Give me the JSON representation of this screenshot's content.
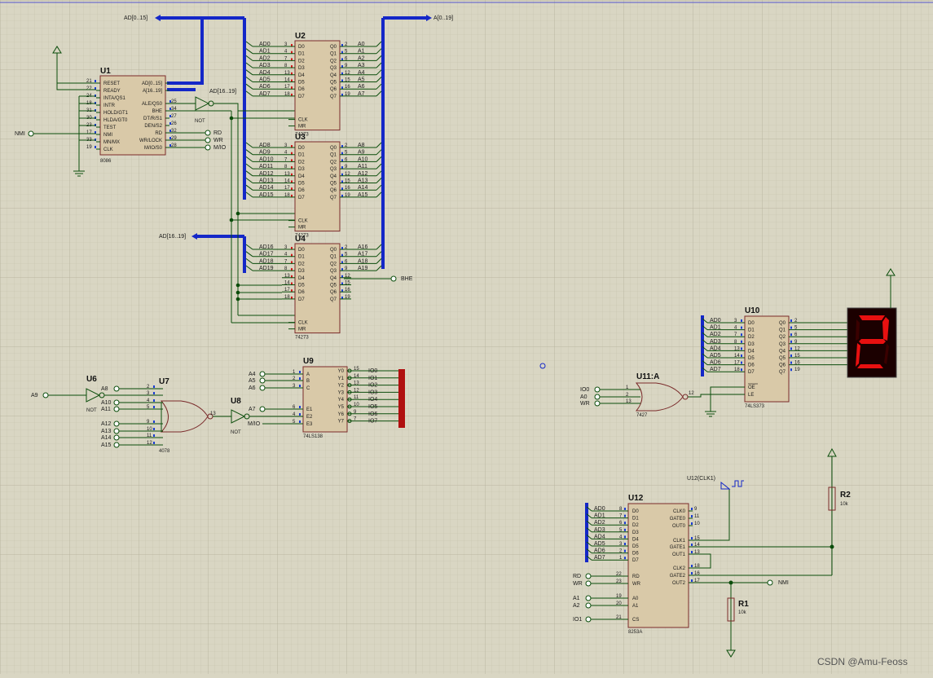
{
  "watermark": "CSDN @Amu-Feoss",
  "buses": {
    "ad0_15": "AD[0..15]",
    "a0_19": "A[0..19]",
    "ad16_19": "AD[16..19]",
    "ad16_19_b": "AD[16..19]"
  },
  "u1": {
    "ref": "U1",
    "part": "8086",
    "left_pins": [
      "RESET",
      "READY",
      "INTA/QS1",
      "INTR",
      "HOLD/GT1",
      "HLDA/GT0",
      "TEST",
      "NMI",
      "MN/MX",
      "CLK"
    ],
    "left_nums": [
      "21",
      "22",
      "24",
      "18",
      "31",
      "30",
      "23",
      "17",
      "33",
      "19"
    ],
    "right_pins": [
      "AD[0..15]",
      "A[16..19]",
      "ALE/QS0",
      "BHE",
      "DT/R/S1",
      "DEN/S2",
      "RD",
      "WR/LOCK",
      "M/IO/S0"
    ],
    "right_nums": [
      "",
      "",
      "25",
      "34",
      "27",
      "26",
      "32",
      "29",
      "28"
    ]
  },
  "nmi_label": "NMI",
  "not_gate": "NOT",
  "signals": {
    "rd": "RD",
    "wr": "WR",
    "mio": "M/IO",
    "bhe": "BHE",
    "a9": "A9",
    "nmi": "NMI"
  },
  "latch": {
    "part": "74273",
    "d_pins": [
      "D0",
      "D1",
      "D2",
      "D3",
      "D4",
      "D5",
      "D6",
      "D7"
    ],
    "q_pins": [
      "Q0",
      "Q1",
      "Q2",
      "Q3",
      "Q4",
      "Q5",
      "Q6",
      "Q7"
    ],
    "clk": "CLK",
    "mr": "MR",
    "left_nums": [
      "3",
      "4",
      "7",
      "8",
      "13",
      "14",
      "17",
      "18"
    ],
    "right_nums": [
      "2",
      "5",
      "6",
      "9",
      "12",
      "15",
      "16",
      "19"
    ]
  },
  "u2": {
    "ref": "U2",
    "inputs": [
      "AD0",
      "AD1",
      "AD2",
      "AD3",
      "AD4",
      "AD5",
      "AD6",
      "AD7"
    ],
    "outputs": [
      "A0",
      "A1",
      "A2",
      "A3",
      "A4",
      "A5",
      "A6",
      "A7"
    ]
  },
  "u3": {
    "ref": "U3",
    "inputs": [
      "AD8",
      "AD9",
      "AD10",
      "AD11",
      "AD12",
      "AD13",
      "AD14",
      "AD15"
    ],
    "outputs": [
      "A8",
      "A9",
      "A10",
      "A11",
      "A12",
      "A13",
      "A14",
      "A15"
    ]
  },
  "u4": {
    "ref": "U4",
    "inputs": [
      "AD16",
      "AD17",
      "AD18",
      "AD19"
    ],
    "outputs": [
      "A16",
      "A17",
      "A18",
      "A19"
    ]
  },
  "u6": {
    "ref": "U6",
    "part": "NOT"
  },
  "u7": {
    "ref": "U7",
    "part": "4078",
    "inputs": [
      "A8",
      "A10",
      "A11",
      "A12",
      "A13",
      "A14",
      "A15"
    ],
    "nums": [
      "2",
      "3",
      "4",
      "5",
      "9",
      "10",
      "11",
      "12"
    ],
    "out": "13"
  },
  "u8": {
    "ref": "U8",
    "part": "NOT"
  },
  "u9": {
    "ref": "U9",
    "part": "74LS138",
    "left_pins": [
      "A",
      "B",
      "C",
      "E1",
      "E2",
      "E3"
    ],
    "left_nums": [
      "1",
      "2",
      "3",
      "6",
      "4",
      "5"
    ],
    "inputs": [
      "A4",
      "A5",
      "A6",
      "A7",
      "M/IO"
    ],
    "right_pins": [
      "Y0",
      "Y1",
      "Y2",
      "Y3",
      "Y4",
      "Y5",
      "Y6",
      "Y7"
    ],
    "right_nums": [
      "15",
      "14",
      "13",
      "12",
      "11",
      "10",
      "9",
      "7"
    ],
    "outputs": [
      "IO0",
      "IO1",
      "IO2",
      "IO3",
      "IO4",
      "IO5",
      "IO6",
      "IO7"
    ],
    "states": [
      "0",
      "1",
      "1",
      "1",
      "1",
      "1",
      "1",
      "1"
    ]
  },
  "u10": {
    "ref": "U10",
    "part": "74LS373",
    "inputs": [
      "AD0",
      "AD1",
      "AD2",
      "AD3",
      "AD4",
      "AD5",
      "AD6",
      "AD7"
    ],
    "d_pins": [
      "D0",
      "D1",
      "D2",
      "D3",
      "D4",
      "D5",
      "D6",
      "D7"
    ],
    "q_pins": [
      "Q0",
      "Q1",
      "Q2",
      "Q3",
      "Q4",
      "Q5",
      "Q6",
      "Q7"
    ],
    "left_nums": [
      "3",
      "4",
      "7",
      "8",
      "13",
      "14",
      "17",
      "18"
    ],
    "right_nums": [
      "2",
      "5",
      "6",
      "9",
      "12",
      "15",
      "16",
      "19"
    ],
    "oe": "OE",
    "le": "LE"
  },
  "u11": {
    "ref": "U11:A",
    "part": "7427",
    "inputs": [
      "IO0",
      "A0",
      "WR"
    ],
    "nums": [
      "1",
      "2",
      "13"
    ],
    "out": "12"
  },
  "display": {
    "digit": "2",
    "color": "#e81010"
  },
  "u12": {
    "ref": "U12",
    "part": "8253A",
    "clock_label": "U12(CLK1)",
    "inputs": [
      "AD0",
      "AD1",
      "AD2",
      "AD3",
      "AD4",
      "AD5",
      "AD6",
      "AD7"
    ],
    "d_pins": [
      "D0",
      "D1",
      "D2",
      "D3",
      "D4",
      "D5",
      "D6",
      "D7"
    ],
    "left_nums": [
      "8",
      "7",
      "6",
      "5",
      "4",
      "3",
      "2",
      "1"
    ],
    "ctrl_pins": [
      "RD",
      "WR",
      "A0",
      "A1",
      "CS"
    ],
    "ctrl_nums": [
      "22",
      "23",
      "19",
      "20",
      "21"
    ],
    "ctrl_inputs": [
      "RD",
      "WR",
      "A1",
      "A2",
      "IO1"
    ],
    "right_pins": [
      "CLK0",
      "GATE0",
      "OUT0",
      "CLK1",
      "GATE1",
      "OUT1",
      "CLK2",
      "GATE2",
      "OUT2"
    ],
    "right_nums": [
      "9",
      "11",
      "10",
      "15",
      "14",
      "13",
      "18",
      "16",
      "17"
    ]
  },
  "r1": {
    "ref": "R1",
    "value": "10k"
  },
  "r2": {
    "ref": "R2",
    "value": "10k"
  }
}
